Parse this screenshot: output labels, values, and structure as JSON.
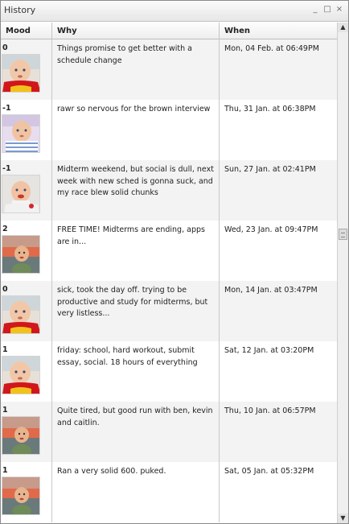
{
  "window": {
    "title": "History"
  },
  "window_controls": [
    "_",
    "□",
    "×"
  ],
  "columns": {
    "mood": "Mood",
    "why": "Why",
    "when": "When"
  },
  "entries": [
    {
      "mood": "0",
      "avatar": "toddler-red-shirt-icon",
      "why": "Things promise to get better with a schedule change",
      "when": "Mon, 04 Feb. at 06:49PM"
    },
    {
      "mood": "-1",
      "avatar": "toddler-striped-shirt-icon",
      "why": "rawr so nervous for the brown interview",
      "when": "Thu, 31 Jan. at 06:38PM"
    },
    {
      "mood": "-1",
      "avatar": "toddler-eating-icon",
      "why": "Midterm weekend, but social is dull, next week with new sched is gonna suck, and my race blew solid chunks",
      "when": "Sun, 27 Jan. at 02:41PM"
    },
    {
      "mood": "2",
      "avatar": "child-sunset-icon",
      "why": "FREE TIME! Midterms are ending, apps are in...",
      "when": "Wed, 23 Jan. at 09:47PM"
    },
    {
      "mood": "0",
      "avatar": "toddler-red-shirt-icon",
      "why": "sick, took the day off. trying to be productive and study for midterms, but very listless...",
      "when": "Mon, 14 Jan. at 03:47PM"
    },
    {
      "mood": "1",
      "avatar": "toddler-red-shirt-icon",
      "why": "friday: school, hard workout, submit essay, social. 18 hours of everything",
      "when": "Sat, 12 Jan. at 03:20PM"
    },
    {
      "mood": "1",
      "avatar": "child-sunset-icon",
      "why": "Quite tired, but good run with ben, kevin and caitlin.",
      "when": "Thu, 10 Jan. at 06:57PM"
    },
    {
      "mood": "1",
      "avatar": "child-sunset-icon",
      "why": "Ran a very solid 600. puked.",
      "when": "Sat, 05 Jan. at 05:32PM"
    }
  ],
  "scrollbar": {
    "up_arrow": "▲",
    "down_arrow": "▼"
  }
}
